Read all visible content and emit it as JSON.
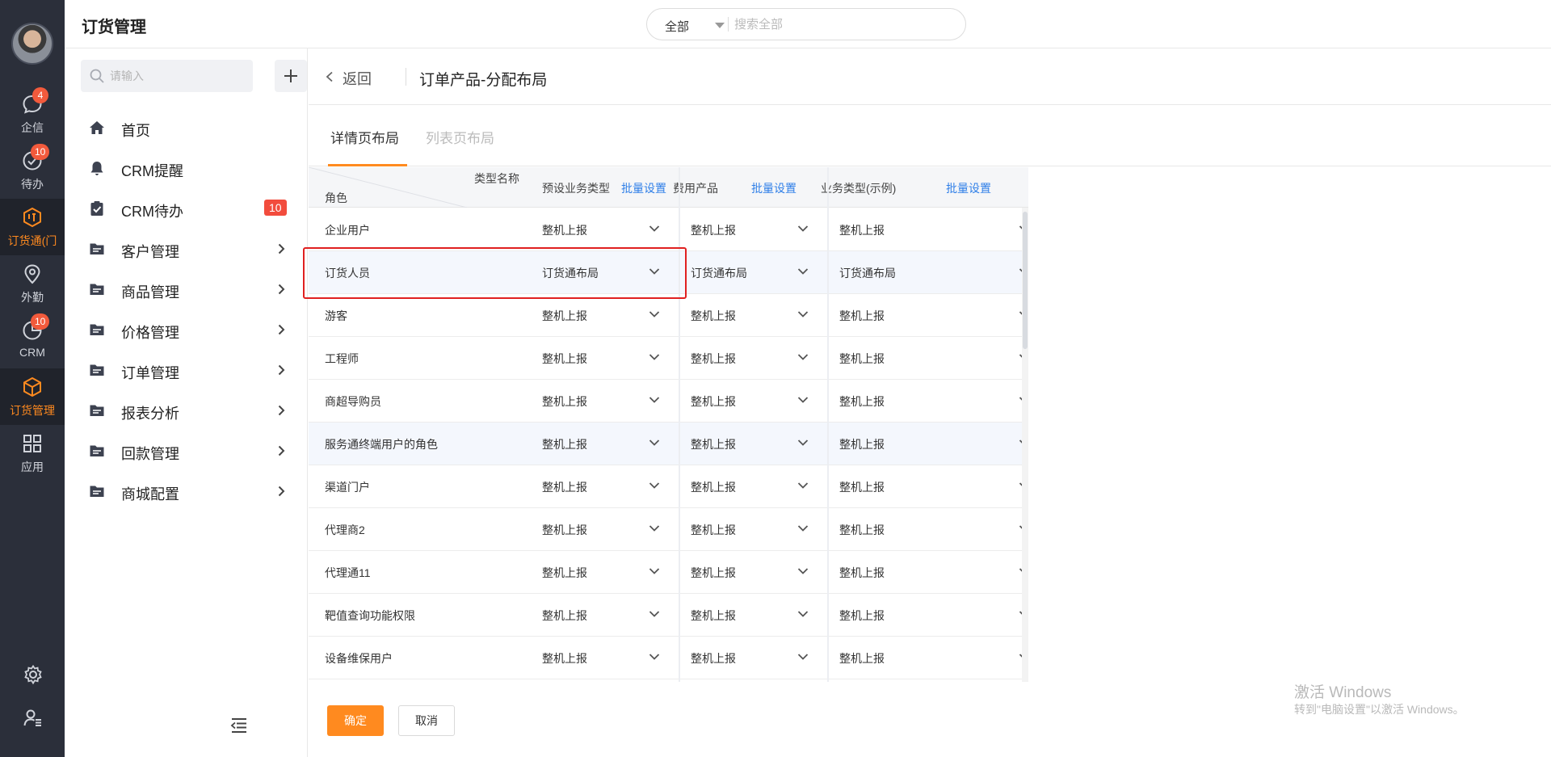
{
  "rail": {
    "items": [
      {
        "label": "企信",
        "badge": "4"
      },
      {
        "label": "待办",
        "badge": "10"
      },
      {
        "label": "订货通(门",
        "badge": ""
      },
      {
        "label": "外勤",
        "badge": ""
      },
      {
        "label": "CRM",
        "badge": "10"
      },
      {
        "label": "订货管理",
        "badge": ""
      },
      {
        "label": "应用",
        "badge": ""
      }
    ],
    "accent_color": "#ff8a1f"
  },
  "header": {
    "title": "订货管理",
    "search_scope": "全部",
    "search_placeholder": "搜索全部"
  },
  "sidebar": {
    "search_placeholder": "请输入",
    "items": [
      {
        "label": "首页",
        "icon": "home-icon",
        "badge": ""
      },
      {
        "label": "CRM提醒",
        "icon": "bell-icon",
        "badge": ""
      },
      {
        "label": "CRM待办",
        "icon": "clipboard-check-icon",
        "badge": "10"
      },
      {
        "label": "客户管理",
        "icon": "folder-icon",
        "badge": ""
      },
      {
        "label": "商品管理",
        "icon": "folder-icon",
        "badge": ""
      },
      {
        "label": "价格管理",
        "icon": "folder-icon",
        "badge": ""
      },
      {
        "label": "订单管理",
        "icon": "folder-icon",
        "badge": ""
      },
      {
        "label": "报表分析",
        "icon": "folder-icon",
        "badge": ""
      },
      {
        "label": "回款管理",
        "icon": "folder-icon",
        "badge": ""
      },
      {
        "label": "商城配置",
        "icon": "folder-icon",
        "badge": ""
      }
    ]
  },
  "page": {
    "back_label": "返回",
    "title": "订单产品-分配布局",
    "tabs": [
      {
        "label": "详情页布局",
        "active": true
      },
      {
        "label": "列表页布局",
        "active": false
      }
    ]
  },
  "table": {
    "corner_type_label": "类型名称",
    "corner_role_label": "角色",
    "batch_label": "批量设置",
    "columns": [
      "预设业务类型",
      "费用产品",
      "业务类型(示例)"
    ],
    "rows": [
      {
        "role": "企业用户",
        "values": [
          "整机上报",
          "整机上报",
          "整机上报"
        ]
      },
      {
        "role": "订货人员",
        "values": [
          "订货通布局",
          "订货通布局",
          "订货通布局"
        ]
      },
      {
        "role": "游客",
        "values": [
          "整机上报",
          "整机上报",
          "整机上报"
        ]
      },
      {
        "role": "工程师",
        "values": [
          "整机上报",
          "整机上报",
          "整机上报"
        ]
      },
      {
        "role": "商超导购员",
        "values": [
          "整机上报",
          "整机上报",
          "整机上报"
        ]
      },
      {
        "role": "服务通终端用户的角色",
        "values": [
          "整机上报",
          "整机上报",
          "整机上报"
        ]
      },
      {
        "role": "渠道门户",
        "values": [
          "整机上报",
          "整机上报",
          "整机上报"
        ]
      },
      {
        "role": "代理商2",
        "values": [
          "整机上报",
          "整机上报",
          "整机上报"
        ]
      },
      {
        "role": "代理通11",
        "values": [
          "整机上报",
          "整机上报",
          "整机上报"
        ]
      },
      {
        "role": "靶值查询功能权限",
        "values": [
          "整机上报",
          "整机上报",
          "整机上报"
        ]
      },
      {
        "role": "设备维保用户",
        "values": [
          "整机上报",
          "整机上报",
          "整机上报"
        ]
      }
    ]
  },
  "footer": {
    "ok_label": "确定",
    "cancel_label": "取消"
  },
  "watermark": {
    "title": "激活 Windows",
    "subtitle": "转到\"电脑设置\"以激活 Windows。"
  }
}
